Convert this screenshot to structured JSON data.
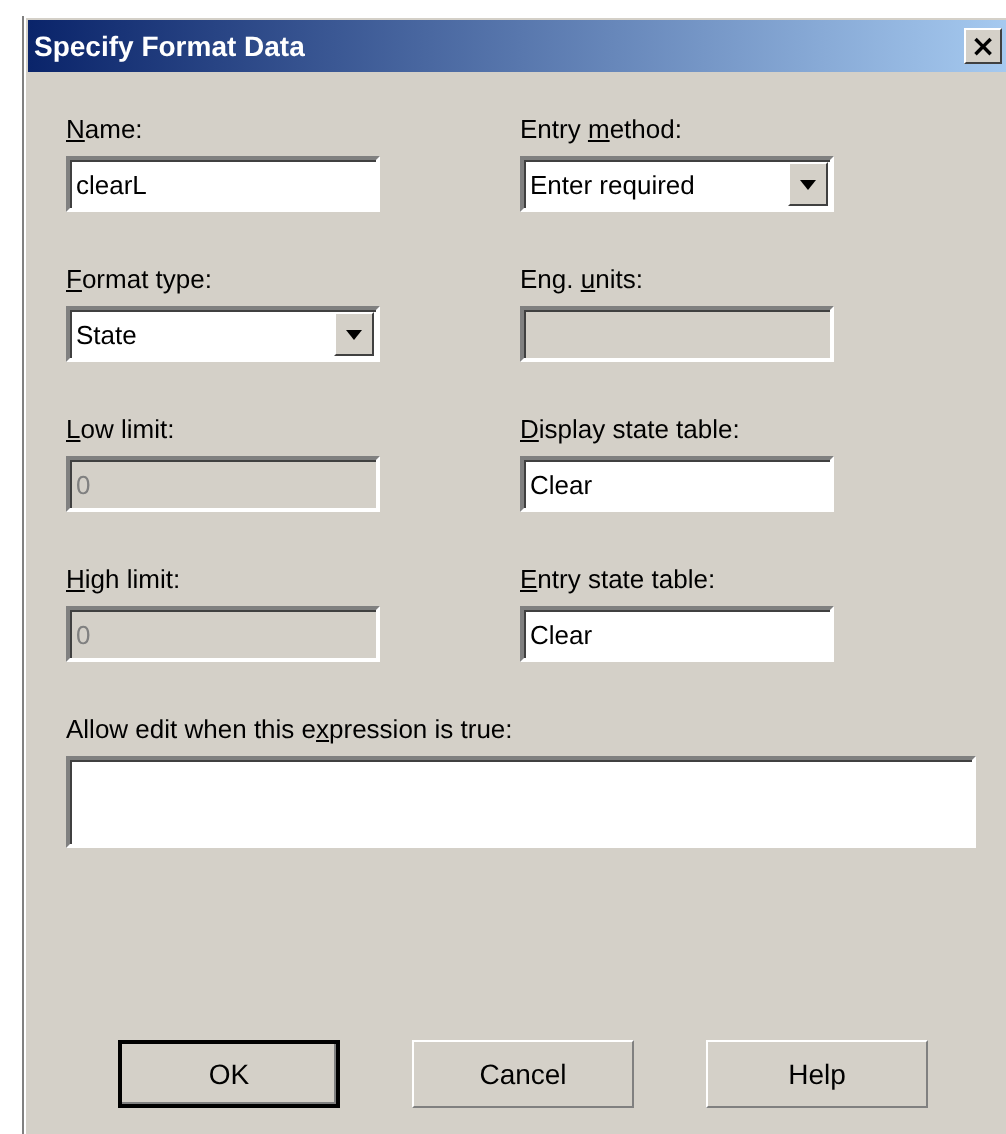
{
  "window": {
    "title": "Specify Format Data",
    "close_icon": "×"
  },
  "fields": [
    {
      "kind": "text",
      "label": [
        {
          "text": "N",
          "underline": true
        },
        {
          "text": "ame:",
          "underline": false
        }
      ],
      "value": "clearL",
      "disabled": false
    },
    {
      "kind": "dropdown",
      "label": [
        {
          "text": "Entry ",
          "underline": false
        },
        {
          "text": "m",
          "underline": true
        },
        {
          "text": "ethod:",
          "underline": false
        }
      ],
      "value": "Enter required",
      "disabled": false
    },
    {
      "kind": "dropdown",
      "label": [
        {
          "text": "F",
          "underline": true
        },
        {
          "text": "ormat type:",
          "underline": false
        }
      ],
      "value": "State",
      "disabled": false
    },
    {
      "kind": "text",
      "label": [
        {
          "text": "Eng. ",
          "underline": false
        },
        {
          "text": "u",
          "underline": true
        },
        {
          "text": "nits:",
          "underline": false
        }
      ],
      "disabled": true
    },
    {
      "kind": "text",
      "label": [
        {
          "text": "L",
          "underline": true
        },
        {
          "text": "ow limit:",
          "underline": false
        }
      ],
      "value": "0",
      "disabled": true
    },
    {
      "kind": "text",
      "label": [
        {
          "text": "D",
          "underline": true
        },
        {
          "text": "isplay state table:",
          "underline": false
        }
      ],
      "value": "Clear",
      "disabled": false
    },
    {
      "kind": "text",
      "label": [
        {
          "text": "H",
          "underline": true
        },
        {
          "text": "igh limit:",
          "underline": false
        }
      ],
      "value": "0",
      "disabled": true
    },
    {
      "kind": "text",
      "label": [
        {
          "text": "E",
          "underline": true
        },
        {
          "text": "ntry state table:",
          "underline": false
        }
      ],
      "value": "Clear",
      "disabled": false
    }
  ],
  "expression": {
    "label": [
      {
        "text": "Allow edit when this e",
        "underline": false
      },
      {
        "text": "x",
        "underline": true
      },
      {
        "text": "pression is true:",
        "underline": false
      }
    ],
    "disabled": false
  },
  "buttons": [
    {
      "label": "OK",
      "default": true
    },
    {
      "label": "Cancel",
      "default": false
    },
    {
      "label": "Help",
      "default": false
    }
  ]
}
